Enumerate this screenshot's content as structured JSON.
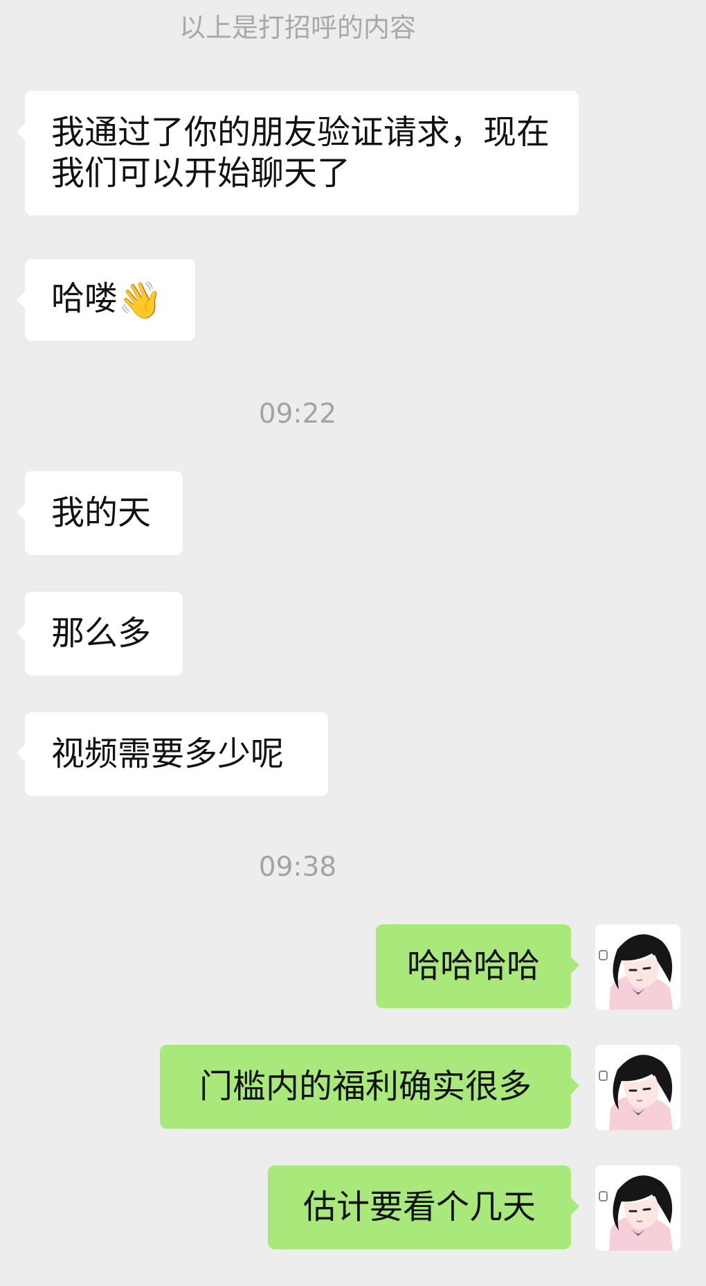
{
  "system_notice": "以上是打招呼的内容",
  "timestamps": [
    "09:22",
    "09:38"
  ],
  "messages": [
    {
      "side": "left",
      "text": "我通过了你的朋友验证请求，现在我们可以开始聊天了"
    },
    {
      "side": "left",
      "text": "哈喽",
      "emoji": "👋"
    },
    {
      "side": "left",
      "text": "我的天"
    },
    {
      "side": "left",
      "text": "那么多"
    },
    {
      "side": "left",
      "text": "视频需要多少呢"
    },
    {
      "side": "right",
      "text": "哈哈哈哈"
    },
    {
      "side": "right",
      "text": "门槛内的福利确实很多"
    },
    {
      "side": "right",
      "text": "估计要看个几天"
    }
  ],
  "colors": {
    "background": "#ededed",
    "incoming_bubble": "#ffffff",
    "outgoing_bubble": "#a9e87a",
    "meta_text": "#a8a8a8"
  },
  "icons": {
    "avatar": "anime-girl-avatar"
  }
}
